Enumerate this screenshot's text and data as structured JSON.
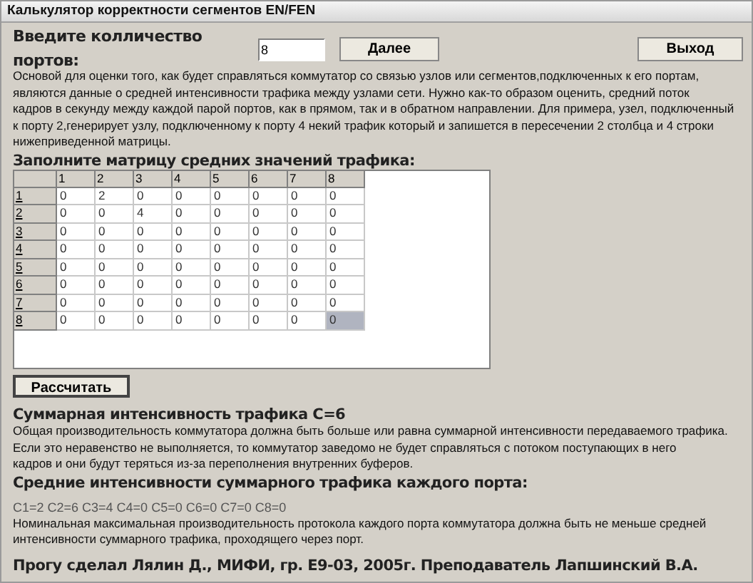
{
  "window": {
    "title": "Калькулятор корректности сегментов EN/FEN"
  },
  "ports": {
    "label": "Введите колличество портов:",
    "value": "8"
  },
  "buttons": {
    "next": "Далее",
    "exit": "Выход",
    "calculate": "Рассчитать"
  },
  "intro": [
    "Основой для оценки того, как будет справляться коммутатор со связью узлов или сегментов,подключенных к его портам,",
    "являются данные о средней интенсивности трафика между узлами сети. Нужно как-то образом оценить, средний поток",
    "кадров в секунду между каждой парой портов, как в прямом, так и в обратном направлении. Для примера, узел, подключенный",
    "к порту 2,генерирует узлу, подключенному к порту 4 некий трафик который и запишется в пересечении 2 столбца и 4 строки",
    "нижеприведенной матрицы."
  ],
  "matrix": {
    "title": "Заполните матрицу средних значений трафика:",
    "columns": [
      "1",
      "2",
      "3",
      "4",
      "5",
      "6",
      "7",
      "8"
    ],
    "rows": [
      {
        "label": "1",
        "cells": [
          {
            "value": "0",
            "selected": false
          },
          {
            "value": "2",
            "selected": false
          },
          {
            "value": "0",
            "selected": false
          },
          {
            "value": "0",
            "selected": false
          },
          {
            "value": "0",
            "selected": false
          },
          {
            "value": "0",
            "selected": false
          },
          {
            "value": "0",
            "selected": false
          },
          {
            "value": "0",
            "selected": false
          }
        ]
      },
      {
        "label": "2",
        "cells": [
          {
            "value": "0",
            "selected": false
          },
          {
            "value": "0",
            "selected": false
          },
          {
            "value": "4",
            "selected": false
          },
          {
            "value": "0",
            "selected": false
          },
          {
            "value": "0",
            "selected": false
          },
          {
            "value": "0",
            "selected": false
          },
          {
            "value": "0",
            "selected": false
          },
          {
            "value": "0",
            "selected": false
          }
        ]
      },
      {
        "label": "3",
        "cells": [
          {
            "value": "0",
            "selected": false
          },
          {
            "value": "0",
            "selected": false
          },
          {
            "value": "0",
            "selected": false
          },
          {
            "value": "0",
            "selected": false
          },
          {
            "value": "0",
            "selected": false
          },
          {
            "value": "0",
            "selected": false
          },
          {
            "value": "0",
            "selected": false
          },
          {
            "value": "0",
            "selected": false
          }
        ]
      },
      {
        "label": "4",
        "cells": [
          {
            "value": "0",
            "selected": false
          },
          {
            "value": "0",
            "selected": false
          },
          {
            "value": "0",
            "selected": false
          },
          {
            "value": "0",
            "selected": false
          },
          {
            "value": "0",
            "selected": false
          },
          {
            "value": "0",
            "selected": false
          },
          {
            "value": "0",
            "selected": false
          },
          {
            "value": "0",
            "selected": false
          }
        ]
      },
      {
        "label": "5",
        "cells": [
          {
            "value": "0",
            "selected": false
          },
          {
            "value": "0",
            "selected": false
          },
          {
            "value": "0",
            "selected": false
          },
          {
            "value": "0",
            "selected": false
          },
          {
            "value": "0",
            "selected": false
          },
          {
            "value": "0",
            "selected": false
          },
          {
            "value": "0",
            "selected": false
          },
          {
            "value": "0",
            "selected": false
          }
        ]
      },
      {
        "label": "6",
        "cells": [
          {
            "value": "0",
            "selected": false
          },
          {
            "value": "0",
            "selected": false
          },
          {
            "value": "0",
            "selected": false
          },
          {
            "value": "0",
            "selected": false
          },
          {
            "value": "0",
            "selected": false
          },
          {
            "value": "0",
            "selected": false
          },
          {
            "value": "0",
            "selected": false
          },
          {
            "value": "0",
            "selected": false
          }
        ]
      },
      {
        "label": "7",
        "cells": [
          {
            "value": "0",
            "selected": false
          },
          {
            "value": "0",
            "selected": false
          },
          {
            "value": "0",
            "selected": false
          },
          {
            "value": "0",
            "selected": false
          },
          {
            "value": "0",
            "selected": false
          },
          {
            "value": "0",
            "selected": false
          },
          {
            "value": "0",
            "selected": false
          },
          {
            "value": "0",
            "selected": false
          }
        ]
      },
      {
        "label": "8",
        "cells": [
          {
            "value": "0",
            "selected": false
          },
          {
            "value": "0",
            "selected": false
          },
          {
            "value": "0",
            "selected": false
          },
          {
            "value": "0",
            "selected": false
          },
          {
            "value": "0",
            "selected": false
          },
          {
            "value": "0",
            "selected": false
          },
          {
            "value": "0",
            "selected": false
          },
          {
            "value": "0",
            "selected": true
          }
        ]
      }
    ]
  },
  "total": {
    "heading": "Суммарная интенсивность трафика C=6",
    "lines": [
      "Общая производительность коммутатора должна быть больше или равна суммарной интенсивности передаваемого трафика.",
      "Если это неравенство не выполняется, то коммутатор заведомо не будет справляться с потоком поступающих в него",
      "кадров и они будут теряться из-за переполнения внутренних буферов."
    ]
  },
  "ports_traffic": {
    "heading": "Средние интенсивности суммарного трафика каждого порта:",
    "values": "C1=2 C2=6 C3=4 C4=0 C5=0 C6=0 C7=0 C8=0",
    "lines": [
      "Номинальная максимальная производительность протокола каждого порта коммутатора должна быть не меньше средней",
      "интенсивности суммарного трафика, проходящего через порт."
    ]
  },
  "footer": "Прогу сделал Лялин Д., МИФИ, гр. Е9-03, 2005г.  Преподаватель Лапшинский В.А."
}
